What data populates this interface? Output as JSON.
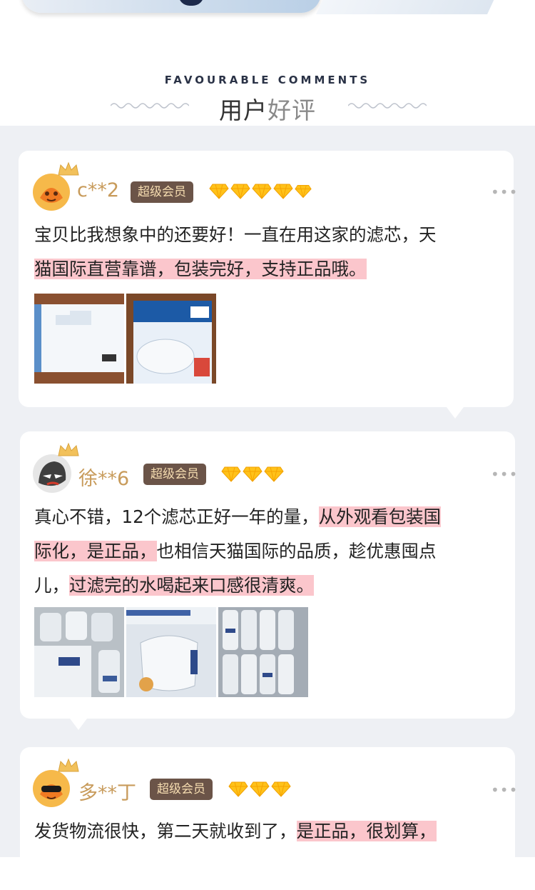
{
  "section": {
    "title_en": "FAVOURABLE COMMENTS",
    "title_zh_main": "用户",
    "title_zh_accent": "好评"
  },
  "colors": {
    "highlight": "#fbc6cc",
    "badge_bg": "#6b5448",
    "badge_text": "#f5dcb0",
    "username": "#c89b5b",
    "background": "#eef0f4"
  },
  "reviews": [
    {
      "username": "c**2",
      "badge": "超级会员",
      "diamond_count": 5,
      "text_plain": "宝贝比我想象中的还要好！一直在用这家的滤芯，天",
      "text_highlight": "猫国际直营靠谱，包装完好，支持正品哦。",
      "photos": [
        "box-side-photo",
        "brita-box-photo"
      ]
    },
    {
      "username": "徐**6",
      "badge": "超级会员",
      "diamond_count": 3,
      "text_a": "真心不错，12个滤芯正好一年的量，",
      "text_b": "从外观看包装国",
      "text_c": "际化，是正品，",
      "text_d": "也相信天猫国际的品质，趁优惠囤点",
      "text_e": "儿，",
      "text_f": "过滤完的水喝起来口感很清爽。",
      "photos": [
        "cartridges-photo-1",
        "cartridge-closeup-photo",
        "cartridges-photo-2"
      ]
    },
    {
      "username": "多**丁",
      "badge": "超级会员",
      "diamond_count": 3,
      "text_plain": "发货物流很快，第二天就收到了，",
      "text_highlight": "是正品，很划算，"
    }
  ]
}
